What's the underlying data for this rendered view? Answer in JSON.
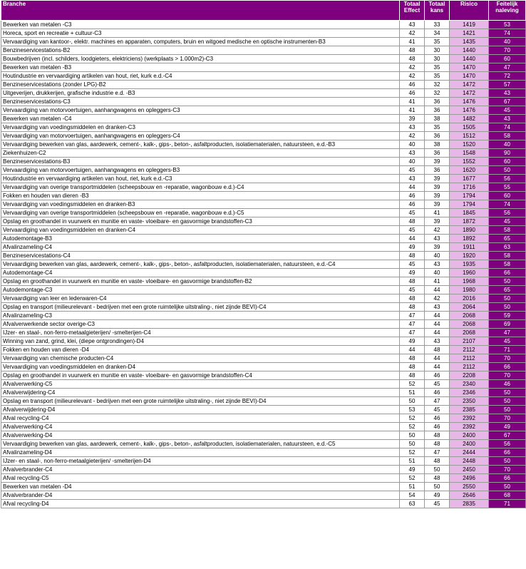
{
  "colors": {
    "header_bg": "#7f007f",
    "risico_bg": "#e7b8e7",
    "naleving_bg": "#7f007f"
  },
  "columns": [
    {
      "label": "Branche"
    },
    {
      "label": "Totaal Effect"
    },
    {
      "label": "Totaal kans"
    },
    {
      "label": "Risico"
    },
    {
      "label": "Feitelijk naleving"
    }
  ],
  "rows": [
    [
      "Bewerken van metalen -C3",
      "43",
      "33",
      "1419",
      "53"
    ],
    [
      "Horeca, sport en recreatie + cultuur-C3",
      "42",
      "34",
      "1421",
      "74"
    ],
    [
      "Vervaardiging van kantoor-, elektr. machines en apparaten, computers, bruin en witgoed medische en optische instrumenten-B3",
      "41",
      "35",
      "1435",
      "40"
    ],
    [
      "Benzineservicestations-B2",
      "48",
      "30",
      "1440",
      "70"
    ],
    [
      "Bouwbedrijven (incl. schilders, loodgieters, elektriciens) (werkplaats > 1.000m2)-C3",
      "48",
      "30",
      "1440",
      "60"
    ],
    [
      "Bewerken van metalen -B3",
      "42",
      "35",
      "1470",
      "47"
    ],
    [
      "Houtindustrie en vervaardiging artikelen van hout, riet, kurk e.d.-C4",
      "42",
      "35",
      "1470",
      "72"
    ],
    [
      "Benzineservicestations (zonder LPG)-B2",
      "46",
      "32",
      "1472",
      "57"
    ],
    [
      "Uitgeverijen, drukkerijen, grafische industrie e.d. -B3",
      "46",
      "32",
      "1472",
      "43"
    ],
    [
      "Benzineservicestations-C3",
      "41",
      "36",
      "1476",
      "67"
    ],
    [
      "Vervaardiging van motorvoertuigen, aanhangwagens en opleggers-C3",
      "41",
      "36",
      "1476",
      "45"
    ],
    [
      "Bewerken van metalen -C4",
      "39",
      "38",
      "1482",
      "43"
    ],
    [
      "Vervaardiging van voedingsmiddelen en dranken-C3",
      "43",
      "35",
      "1505",
      "74"
    ],
    [
      "Vervaardiging van motorvoertuigen, aanhangwagens en opleggers-C4",
      "42",
      "36",
      "1512",
      "58"
    ],
    [
      "Vervaardiging bewerken van glas, aardewerk, cement-, kalk-, gips-, beton-, asfaltproducten, isolatiematerialen, natuursteen, e.d.-B3",
      "40",
      "38",
      "1520",
      "40"
    ],
    [
      "Ziekenhuizen-C2",
      "43",
      "36",
      "1548",
      "90"
    ],
    [
      "Benzineservicestations-B3",
      "40",
      "39",
      "1552",
      "60"
    ],
    [
      "Vervaardiging van motorvoertuigen, aanhangwagens en opleggers-B3",
      "45",
      "36",
      "1620",
      "50"
    ],
    [
      "Houtindustrie en vervaardiging artikelen van hout, riet, kurk e.d.-C3",
      "43",
      "39",
      "1677",
      "56"
    ],
    [
      "Vervaardiging van overige transportmiddelen (scheepsbouw en -reparatie, wagonbouw e.d.)-C4",
      "44",
      "39",
      "1716",
      "55"
    ],
    [
      "Fokken en houden van dieren -B3",
      "46",
      "39",
      "1794",
      "60"
    ],
    [
      "Vervaardiging van voedingsmiddelen en dranken-B3",
      "46",
      "39",
      "1794",
      "74"
    ],
    [
      "Vervaardiging van overige transportmiddelen (scheepsbouw en -reparatie, wagonbouw e.d.)-C5",
      "45",
      "41",
      "1845",
      "56"
    ],
    [
      "Opslag en groothandel in vuurwerk en munitie en vaste- vloeibare- en gasvormige brandstoffen-C3",
      "48",
      "39",
      "1872",
      "45"
    ],
    [
      "Vervaardiging van voedingsmiddelen en dranken-C4",
      "45",
      "42",
      "1890",
      "58"
    ],
    [
      "Autodemontage-B3",
      "44",
      "43",
      "1892",
      "65"
    ],
    [
      "Afvalinzameling-C4",
      "49",
      "39",
      "1911",
      "63"
    ],
    [
      "Benzineservicestations-C4",
      "48",
      "40",
      "1920",
      "58"
    ],
    [
      "Vervaardiging bewerken van glas, aardewerk, cement-, kalk-, gips-, beton-, asfaltproducten, isolatiematerialen, natuursteen, e.d.-C4",
      "45",
      "43",
      "1935",
      "58"
    ],
    [
      "Autodemontage-C4",
      "49",
      "40",
      "1960",
      "66"
    ],
    [
      "Opslag en groothandel in vuurwerk en munitie en vaste- vloeibare- en gasvormige brandstoffen-B2",
      "48",
      "41",
      "1968",
      "50"
    ],
    [
      "Autodemontage-C3",
      "45",
      "44",
      "1980",
      "65"
    ],
    [
      "Vervaardiging van leer en lederwaren-C4",
      "48",
      "42",
      "2016",
      "50"
    ],
    [
      "Opslag en transport (milieurelevant - bedrijven met een grote ruimtelijke uitstraling-, niet zijnde BEVI)-C4",
      "48",
      "43",
      "2064",
      "50"
    ],
    [
      "Afvalinzameling-C3",
      "47",
      "44",
      "2068",
      "59"
    ],
    [
      "Afvalverwerkende sector overige-C3",
      "47",
      "44",
      "2068",
      "69"
    ],
    [
      "IJzer- en staal-, non-ferro-metaalgieterijen/ -smelterijen-C4",
      "47",
      "44",
      "2068",
      "47"
    ],
    [
      "Winning van zand, grind, klei, (diepe ontgrondingen)-D4",
      "49",
      "43",
      "2107",
      "45"
    ],
    [
      "Fokken en houden van dieren -D4",
      "44",
      "48",
      "2112",
      "71"
    ],
    [
      "Vervaardiging van chemische producten-C4",
      "48",
      "44",
      "2112",
      "70"
    ],
    [
      "Vervaardiging van voedingsmiddelen en dranken-D4",
      "48",
      "44",
      "2112",
      "66"
    ],
    [
      "Opslag en groothandel in vuurwerk en munitie en vaste- vloeibare- en gasvormige brandstoffen-C4",
      "48",
      "46",
      "2208",
      "70"
    ],
    [
      "Afvalverwerking-C5",
      "52",
      "45",
      "2340",
      "46"
    ],
    [
      "Afvalverwijdering-C4",
      "51",
      "46",
      "2346",
      "50"
    ],
    [
      "Opslag en transport (milieurelevant - bedrijven met een grote ruimtelijke uitstraling-, niet zijnde BEVI)-D4",
      "50",
      "47",
      "2350",
      "50"
    ],
    [
      "Afvalverwijdering-D4",
      "53",
      "45",
      "2385",
      "50"
    ],
    [
      "Afval recycling-C4",
      "52",
      "46",
      "2392",
      "70"
    ],
    [
      "Afvalverwerking-C4",
      "52",
      "46",
      "2392",
      "49"
    ],
    [
      "Afvalverwerking-D4",
      "50",
      "48",
      "2400",
      "67"
    ],
    [
      "Vervaardiging bewerken van glas, aardewerk, cement-, kalk-, gips-, beton-, asfaltproducten, isolatiematerialen, natuursteen, e.d.-C5",
      "50",
      "48",
      "2400",
      "56"
    ],
    [
      "Afvalinzameling-D4",
      "52",
      "47",
      "2444",
      "66"
    ],
    [
      "IJzer- en staal-, non-ferro-metaalgieterijen/ -smelterijen-D4",
      "51",
      "48",
      "2448",
      "50"
    ],
    [
      "Afvalverbrander-C4",
      "49",
      "50",
      "2450",
      "70"
    ],
    [
      "Afval recycling-C5",
      "52",
      "48",
      "2496",
      "66"
    ],
    [
      "Bewerken van metalen -D4",
      "51",
      "50",
      "2550",
      "50"
    ],
    [
      "Afvalverbrander-D4",
      "54",
      "49",
      "2646",
      "68"
    ],
    [
      "Afval recycling-D4",
      "63",
      "45",
      "2835",
      "71"
    ]
  ]
}
